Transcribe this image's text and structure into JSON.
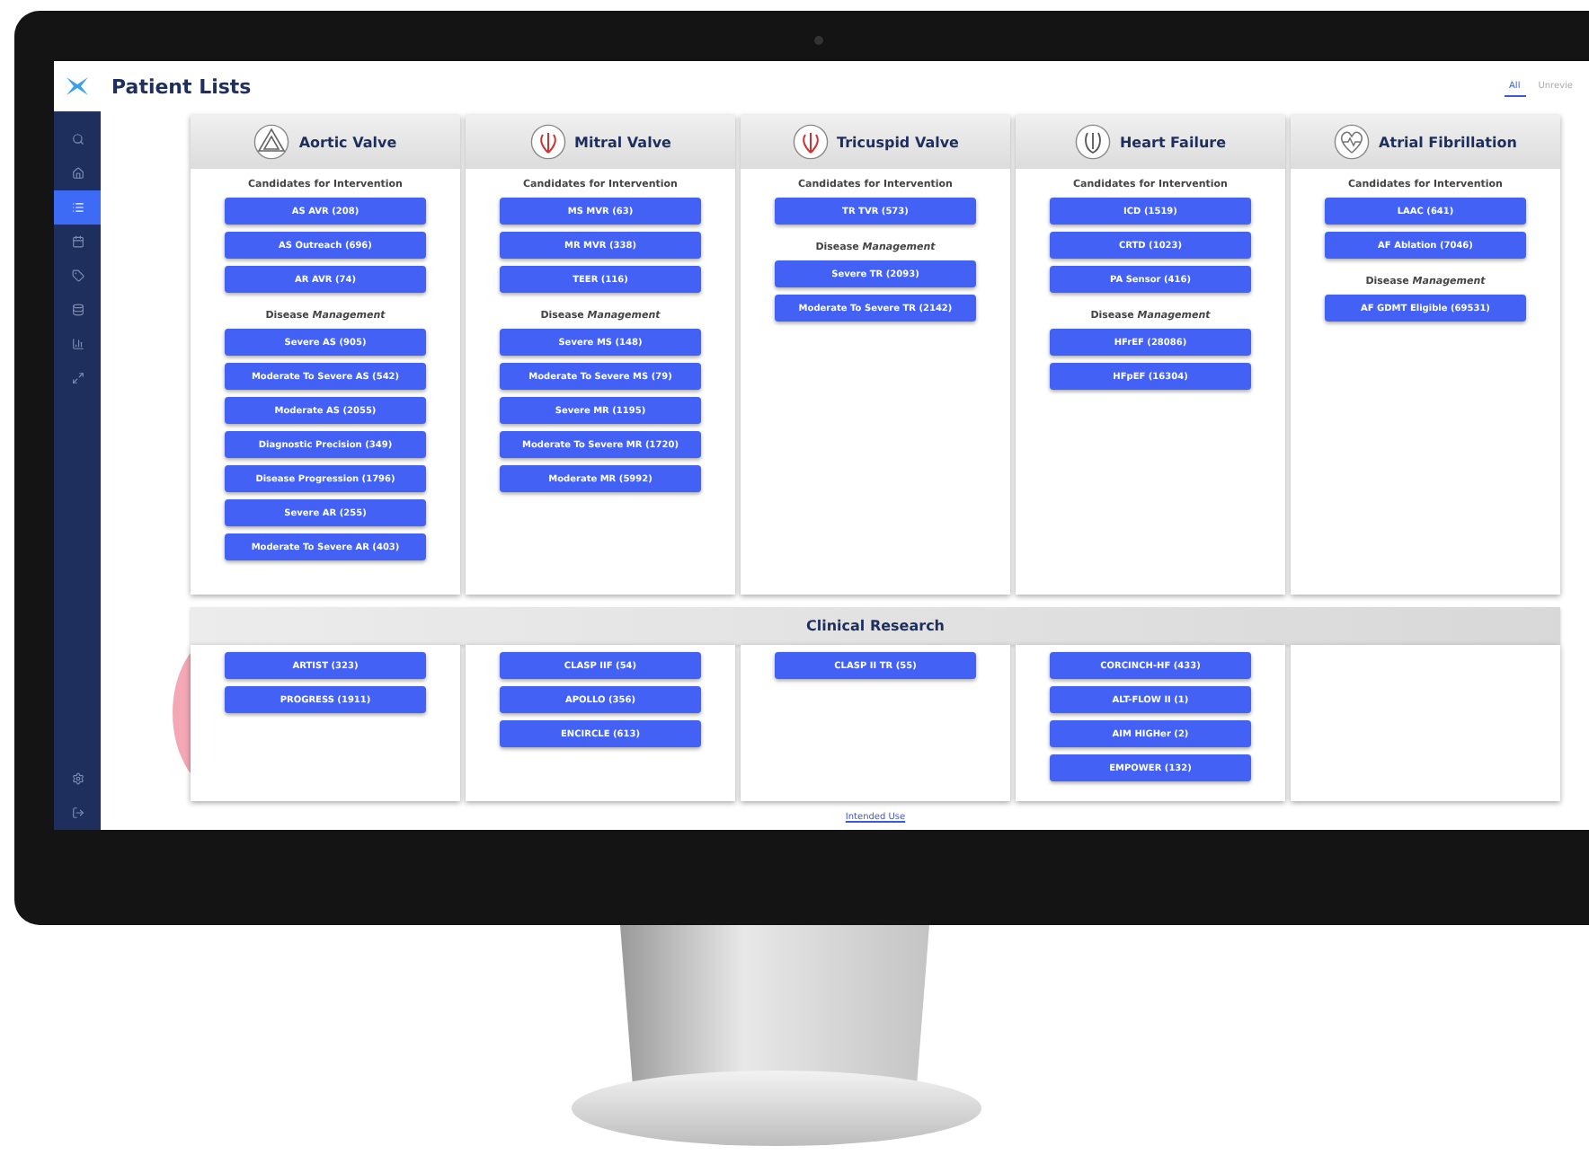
{
  "header": {
    "title": "Patient Lists",
    "tabs": [
      {
        "label": "All",
        "selected": true
      },
      {
        "label": "Unrevie",
        "selected": false
      }
    ]
  },
  "sidebar": {
    "items": [
      {
        "kind": "search",
        "selected": false
      },
      {
        "kind": "home",
        "selected": false
      },
      {
        "kind": "list",
        "selected": true
      },
      {
        "kind": "calendar",
        "selected": false
      },
      {
        "kind": "tag",
        "selected": false
      },
      {
        "kind": "database",
        "selected": false
      },
      {
        "kind": "chart",
        "selected": false
      },
      {
        "kind": "expand",
        "selected": false
      }
    ],
    "bottom": [
      {
        "kind": "settings",
        "selected": false
      },
      {
        "kind": "logout",
        "selected": false
      }
    ]
  },
  "columns": [
    {
      "title": "Aortic Valve",
      "kind": "triangle",
      "sections": [
        {
          "heading": "Candidates for Intervention",
          "items": [
            "AS AVR (208)",
            "AS Outreach (696)",
            "AR AVR (74)"
          ]
        },
        {
          "heading": "Disease *Management*",
          "items": [
            "Severe AS (905)",
            "Moderate To Severe AS (542)",
            "Moderate AS (2055)",
            "Diagnostic Precision (349)",
            "Disease Progression (1796)",
            "Severe AR (255)",
            "Moderate To Severe AR (403)"
          ]
        }
      ]
    },
    {
      "title": "Mitral Valve",
      "kind": "heart",
      "sections": [
        {
          "heading": "Candidates for Intervention",
          "items": [
            "MS MVR (63)",
            "MR MVR (338)",
            "TEER (116)"
          ]
        },
        {
          "heading": "Disease *Management*",
          "items": [
            "Severe MS (148)",
            "Moderate To Severe MS (79)",
            "Severe MR (1195)",
            "Moderate To Severe MR (1720)",
            "Moderate MR (5992)"
          ]
        }
      ]
    },
    {
      "title": "Tricuspid Valve",
      "kind": "heart",
      "sections": [
        {
          "heading": "Candidates for Intervention",
          "items": [
            "TR TVR (573)"
          ]
        },
        {
          "heading": "Disease *Management*",
          "items": [
            "Severe TR (2093)",
            "Moderate To Severe TR (2142)"
          ]
        }
      ]
    },
    {
      "title": "Heart Failure",
      "kind": "organ",
      "sections": [
        {
          "heading": "Candidates for Intervention",
          "items": [
            "ICD (1519)",
            "CRTD (1023)",
            "PA Sensor (416)"
          ]
        },
        {
          "heading": "Disease *Management*",
          "items": [
            "HFrEF (28086)",
            "HFpEF (16304)"
          ]
        }
      ]
    },
    {
      "title": "Atrial Fibrillation",
      "kind": "pulse",
      "sections": [
        {
          "heading": "Candidates for Intervention",
          "items": [
            "LAAC (641)",
            "AF Ablation (7046)"
          ]
        },
        {
          "heading": "Disease *Management*",
          "items": [
            "AF GDMT Eligible (69531)"
          ]
        }
      ]
    }
  ],
  "research": {
    "title": "Clinical Research",
    "columns": [
      [
        "ARTIST (323)",
        "PROGRESS (1911)"
      ],
      [
        "CLASP IIF (54)",
        "APOLLO (356)",
        "ENCIRCLE (613)"
      ],
      [
        "CLASP II TR (55)"
      ],
      [
        "CORCINCH-HF (433)",
        "ALT-FLOW II (1)",
        "AIM HIGHer (2)",
        "EMPOWER (132)"
      ],
      []
    ]
  },
  "footer": {
    "link": "Intended Use"
  }
}
